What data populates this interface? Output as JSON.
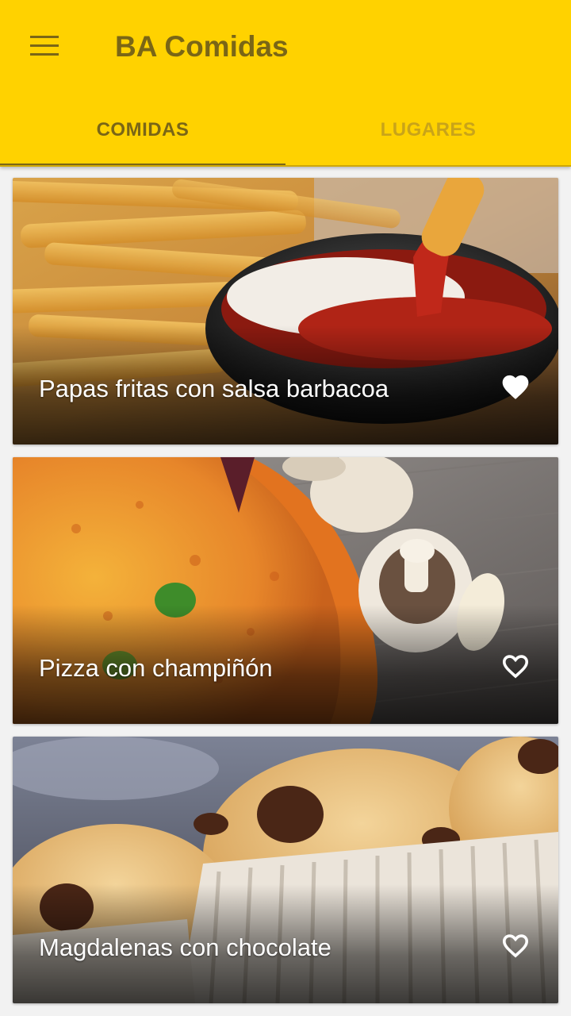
{
  "app": {
    "title": "BA Comidas"
  },
  "tabs": [
    {
      "label": "COMIDAS",
      "active": true
    },
    {
      "label": "LUGARES",
      "active": false
    }
  ],
  "colors": {
    "primary": "#ffd200",
    "primary_text": "#7a6616",
    "inactive_tab_text": "#c9a419"
  },
  "cards": [
    {
      "title": "Papas fritas con salsa barbacoa",
      "favorite": true,
      "icon": "heart-filled-icon"
    },
    {
      "title": "Pizza con champiñón",
      "favorite": false,
      "icon": "heart-outline-icon"
    },
    {
      "title": "Magdalenas con chocolate",
      "favorite": false,
      "icon": "heart-outline-icon"
    }
  ]
}
